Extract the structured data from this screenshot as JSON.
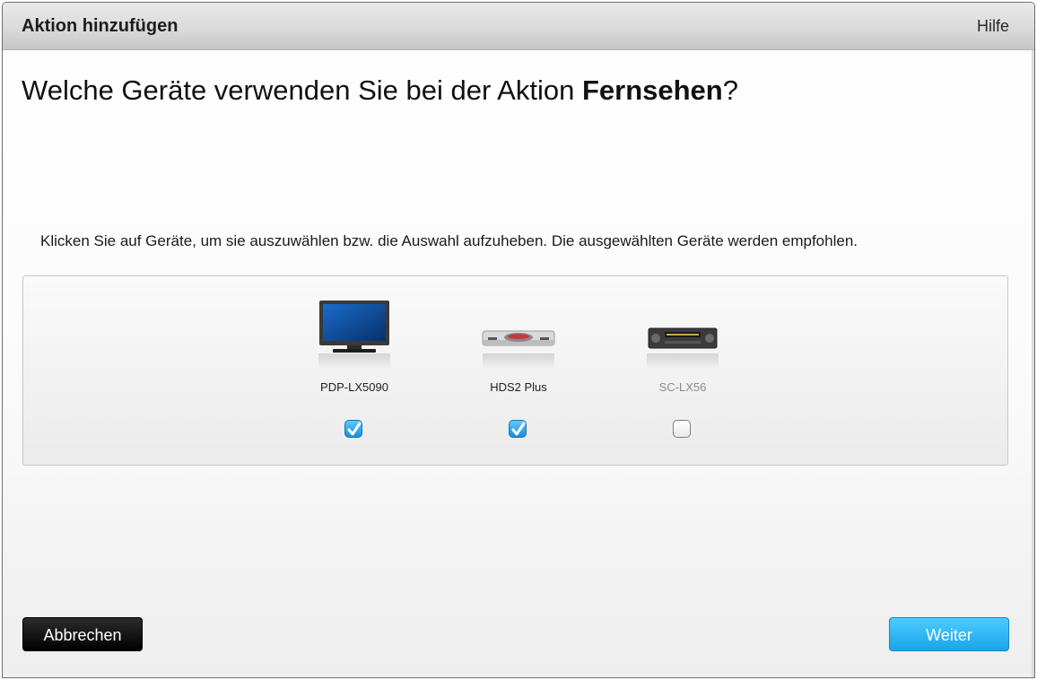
{
  "window": {
    "title": "Aktion hinzufügen",
    "help_label": "Hilfe"
  },
  "question": {
    "prefix": "Welche Geräte verwenden Sie bei der Aktion ",
    "activity": "Fernsehen",
    "suffix": "?"
  },
  "instruction": "Klicken Sie auf Geräte, um sie auszuwählen bzw. die Auswahl aufzuheben. Die ausgewählten Geräte werden empfohlen.",
  "devices": [
    {
      "name": "PDP-LX5090",
      "icon": "television-icon",
      "checked": true
    },
    {
      "name": "HDS2 Plus",
      "icon": "satellite-receiver-icon",
      "checked": true
    },
    {
      "name": "SC-LX56",
      "icon": "av-receiver-icon",
      "checked": false
    }
  ],
  "buttons": {
    "cancel_label": "Abbrechen",
    "next_label": "Weiter"
  },
  "colors": {
    "accent": "#1aa5ec",
    "checkbox_checked": "#2aa6e8",
    "cancel_button": "#000000"
  }
}
